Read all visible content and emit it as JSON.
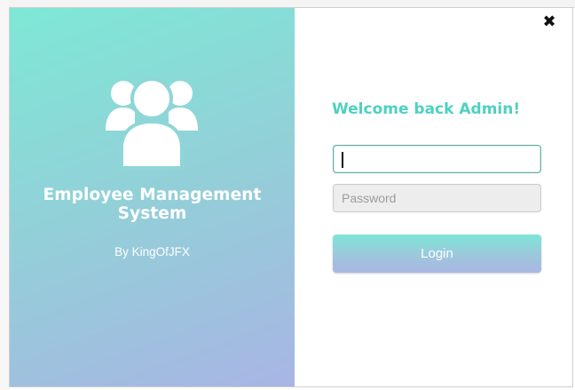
{
  "window": {
    "close_glyph": "✖"
  },
  "left_panel": {
    "icon": "users-group-icon",
    "title": "Employee Management System",
    "byline": "By KingOfJFX"
  },
  "form": {
    "heading": "Welcome back Admin!",
    "username": {
      "value": "",
      "placeholder": ""
    },
    "password": {
      "value": "",
      "placeholder": "Password"
    },
    "login_label": "Login"
  },
  "colors": {
    "gradient_start": "#7ee8d6",
    "gradient_end": "#a8b5e4",
    "accent": "#4fd1c0",
    "text_on_gradient": "#ffffff"
  }
}
